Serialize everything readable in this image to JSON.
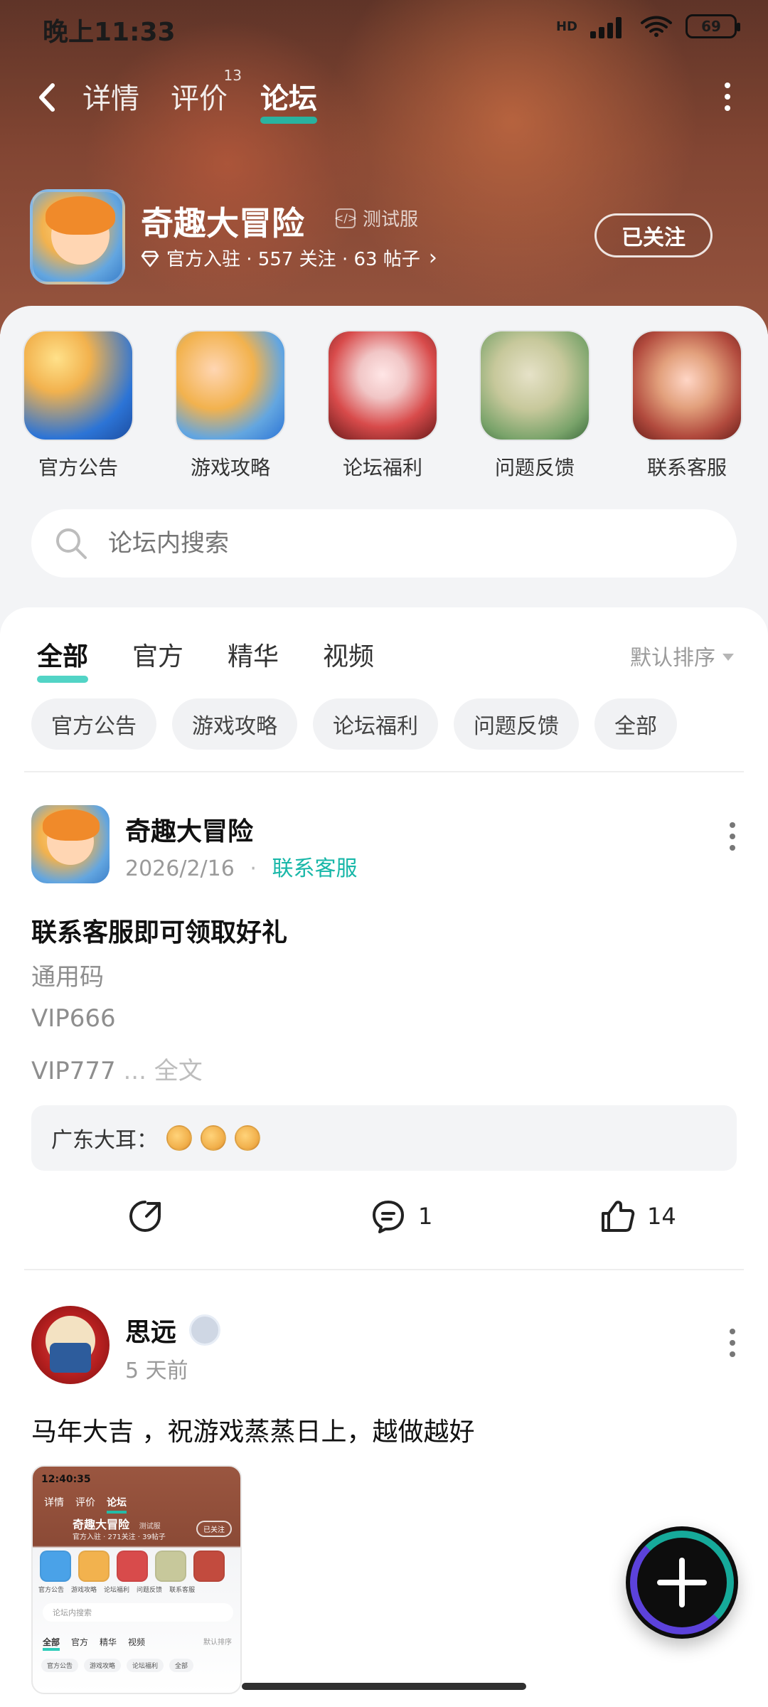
{
  "status": {
    "time": "晚上11:33",
    "hd": "HD",
    "battery": "69"
  },
  "topnav": {
    "tabs": [
      {
        "label": "详情"
      },
      {
        "label": "评价",
        "badge": "13"
      },
      {
        "label": "论坛"
      }
    ]
  },
  "game": {
    "title": "奇趣大冒险",
    "badge": "测试服",
    "meta": "官方入驻 · 557 关注 · 63 帖子",
    "follow_label": "已关注"
  },
  "quick_entries": [
    {
      "label": "官方公告"
    },
    {
      "label": "游戏攻略"
    },
    {
      "label": "论坛福利"
    },
    {
      "label": "问题反馈"
    },
    {
      "label": "联系客服"
    }
  ],
  "search": {
    "placeholder": "论坛内搜索"
  },
  "feed_tabs": [
    {
      "label": "全部"
    },
    {
      "label": "官方"
    },
    {
      "label": "精华"
    },
    {
      "label": "视频"
    }
  ],
  "sort_label": "默认排序",
  "chips": [
    {
      "label": "官方公告"
    },
    {
      "label": "游戏攻略"
    },
    {
      "label": "论坛福利"
    },
    {
      "label": "问题反馈"
    },
    {
      "label": "全部"
    }
  ],
  "posts": [
    {
      "author": "奇趣大冒险",
      "date": "2026/2/16",
      "tag": "联系客服",
      "title": "联系客服即可领取好礼",
      "lines": [
        "通用码",
        "VIP666",
        "VIP777"
      ],
      "more": "... 全文",
      "comment_preview": "广东大耳：",
      "comments": "1",
      "likes": "14"
    },
    {
      "author": "思远",
      "time": "5 天前",
      "text": "马年大吉 ，祝游戏蒸蒸日上，越做越好",
      "thumb": {
        "time": "12:40:35",
        "tabs": [
          "详情",
          "评价",
          "论坛"
        ],
        "title": "奇趣大冒险",
        "badge": "测试服",
        "meta": "官方入驻 · 271关注 · 39帖子",
        "follow": "已关注",
        "labels": [
          "官方公告",
          "游戏攻略",
          "论坛福利",
          "问题反馈",
          "联系客服"
        ],
        "search": "论坛内搜索",
        "feed_tabs": [
          "全部",
          "官方",
          "精华",
          "视频"
        ],
        "sort": "默认排序",
        "chips": [
          "官方公告",
          "游戏攻略",
          "论坛福利",
          "全部"
        ]
      }
    }
  ]
}
